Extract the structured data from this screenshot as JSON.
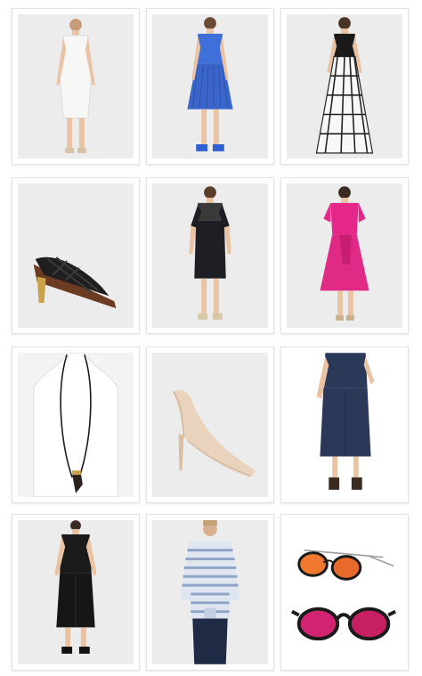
{
  "products": [
    {
      "name": "white-sheath-dress",
      "bg": "#ececec"
    },
    {
      "name": "blue-pleated-dress",
      "bg": "#ececec"
    },
    {
      "name": "black-halter-gingham-gown",
      "bg": "#ececec"
    },
    {
      "name": "black-woven-mule-sandal",
      "bg": "#ececec"
    },
    {
      "name": "black-lace-yoke-dress",
      "bg": "#ececec"
    },
    {
      "name": "pink-wrap-dress",
      "bg": "#ececec"
    },
    {
      "name": "horn-pendant-necklace",
      "bg": "#f3f3f3"
    },
    {
      "name": "nude-pointed-pump",
      "bg": "#ececec"
    },
    {
      "name": "navy-culotte-jumpsuit",
      "bg": "#ffffff"
    },
    {
      "name": "black-jumpsuit",
      "bg": "#ececec"
    },
    {
      "name": "striped-knot-shirt",
      "bg": "#ececec"
    },
    {
      "name": "mirrored-sunglasses",
      "bg": "#ffffff"
    }
  ],
  "colors": {
    "card_border": "#e3e3e3",
    "photo_bg": "#ececec",
    "white_dress": "#f7f7f5",
    "blue_dress": "#3f6fd8",
    "pink_dress": "#e6278a",
    "black": "#1a1a1a",
    "skin": "#e9c3a3",
    "nude_pump": "#ead3bd",
    "navy": "#2c3a5a",
    "stripe_blue": "#8fa4c7",
    "lens_orange": "#f0782f",
    "lens_magenta": "#d1236f"
  }
}
